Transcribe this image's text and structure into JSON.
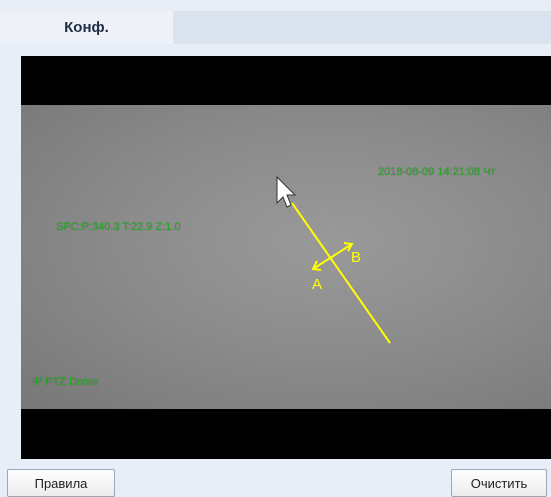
{
  "tabs": {
    "config_label": "Конф."
  },
  "video": {
    "timestamp": "2018-08-09 14:21:08 Чт",
    "ptz_info": "SPC:P:340.3 T:22.9 Z:1.0",
    "camera_name": "IP PTZ Dome",
    "rule_line": {
      "direction_a": "A",
      "direction_b": "B",
      "color": "#ffff00"
    }
  },
  "buttons": {
    "rules_label": "Правила",
    "clear_label": "Очистить"
  }
}
